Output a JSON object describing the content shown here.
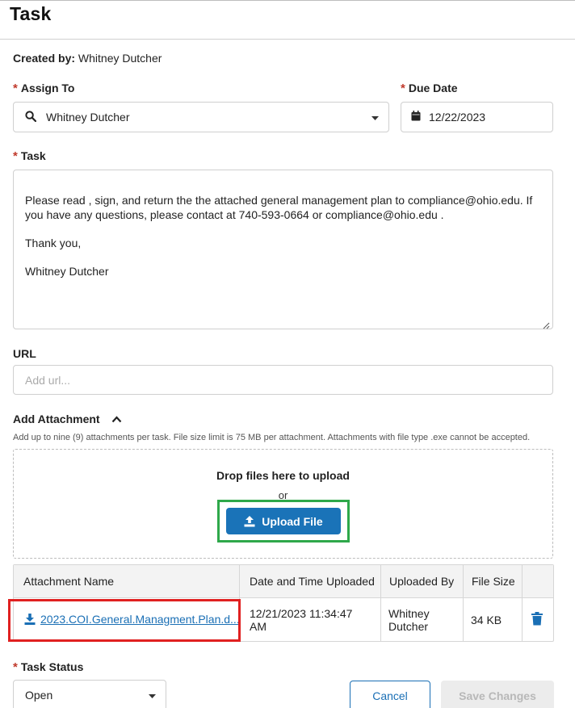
{
  "page": {
    "title": "Task"
  },
  "created_by": {
    "label": "Created by:",
    "value": "Whitney Dutcher"
  },
  "assign_to": {
    "label": "Assign To",
    "value": "Whitney Dutcher",
    "icon": "search-icon"
  },
  "due_date": {
    "label": "Due Date",
    "value": "12/22/2023",
    "icon": "calendar-icon"
  },
  "task": {
    "label": "Task",
    "paragraphs": [
      "Please read , sign, and return the the attached general management plan to compliance@ohio.edu. If you have any questions, please contact at 740-593-0664 or compliance@ohio.edu .",
      "Thank you,",
      "Whitney Dutcher"
    ]
  },
  "url": {
    "label": "URL",
    "placeholder": "Add url..."
  },
  "attachment": {
    "label": "Add Attachment",
    "help": "Add up to nine (9) attachments per task. File size limit is 75 MB per attachment. Attachments with file type .exe cannot be accepted.",
    "drop_text": "Drop files here to upload",
    "or_text": "or",
    "upload_label": "Upload File",
    "columns": [
      "Attachment Name",
      "Date and Time Uploaded",
      "Uploaded By",
      "File Size"
    ],
    "rows": [
      {
        "name": "2023.COI.General.Managment.Plan.d...",
        "uploaded_line1": "12/21/2023 11:34:47",
        "uploaded_line2": "AM",
        "by_line1": "Whitney",
        "by_line2": "Dutcher",
        "size": "34 KB"
      }
    ]
  },
  "task_status": {
    "label": "Task Status",
    "value": "Open"
  },
  "buttons": {
    "cancel": "Cancel",
    "save": "Save Changes"
  },
  "colors": {
    "accent": "#1a73b8",
    "required": "#c0392b",
    "highlight_green": "#2ea84a",
    "highlight_red": "#e02020"
  }
}
